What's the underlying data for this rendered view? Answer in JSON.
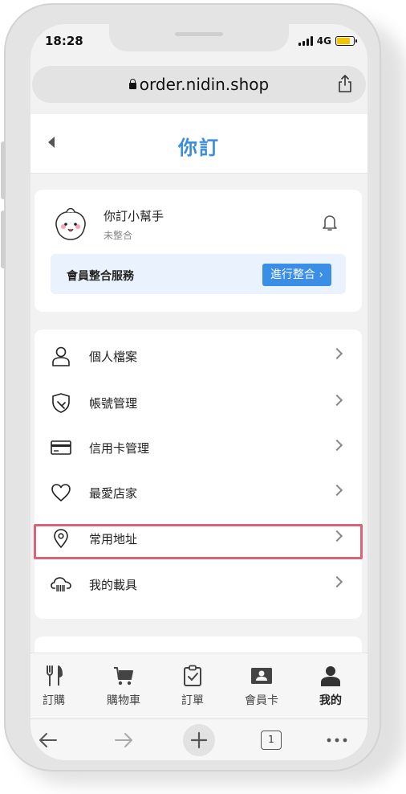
{
  "status_bar": {
    "time": "18:28",
    "network": "4G"
  },
  "browser": {
    "url": "order.nidin.shop",
    "tabs_count": "1"
  },
  "header": {
    "title": "你訂"
  },
  "profile": {
    "name": "你訂小幫手",
    "status": "未整合",
    "integration_label": "會員整合服務",
    "integration_button": "進行整合 ›"
  },
  "menu": {
    "items": [
      {
        "label": "個人檔案",
        "icon": "user-icon"
      },
      {
        "label": "帳號管理",
        "icon": "shield-icon"
      },
      {
        "label": "信用卡管理",
        "icon": "credit-card-icon"
      },
      {
        "label": "最愛店家",
        "icon": "heart-icon"
      },
      {
        "label": "常用地址",
        "icon": "location-pin-icon"
      },
      {
        "label": "我的載具",
        "icon": "cloud-barcode-icon"
      }
    ],
    "highlighted_item": "常用地址"
  },
  "tab_bar": {
    "items": [
      {
        "label": "訂購",
        "icon": "utensils-icon"
      },
      {
        "label": "購物車",
        "icon": "cart-icon"
      },
      {
        "label": "訂單",
        "icon": "clipboard-check-icon"
      },
      {
        "label": "會員卡",
        "icon": "member-card-icon"
      },
      {
        "label": "我的",
        "icon": "person-icon"
      }
    ],
    "active": "我的"
  },
  "colors": {
    "accent": "#3a8ddb",
    "button": "#3b8ee6",
    "highlight": "#d96379",
    "banner_bg": "#eaf3fd"
  }
}
